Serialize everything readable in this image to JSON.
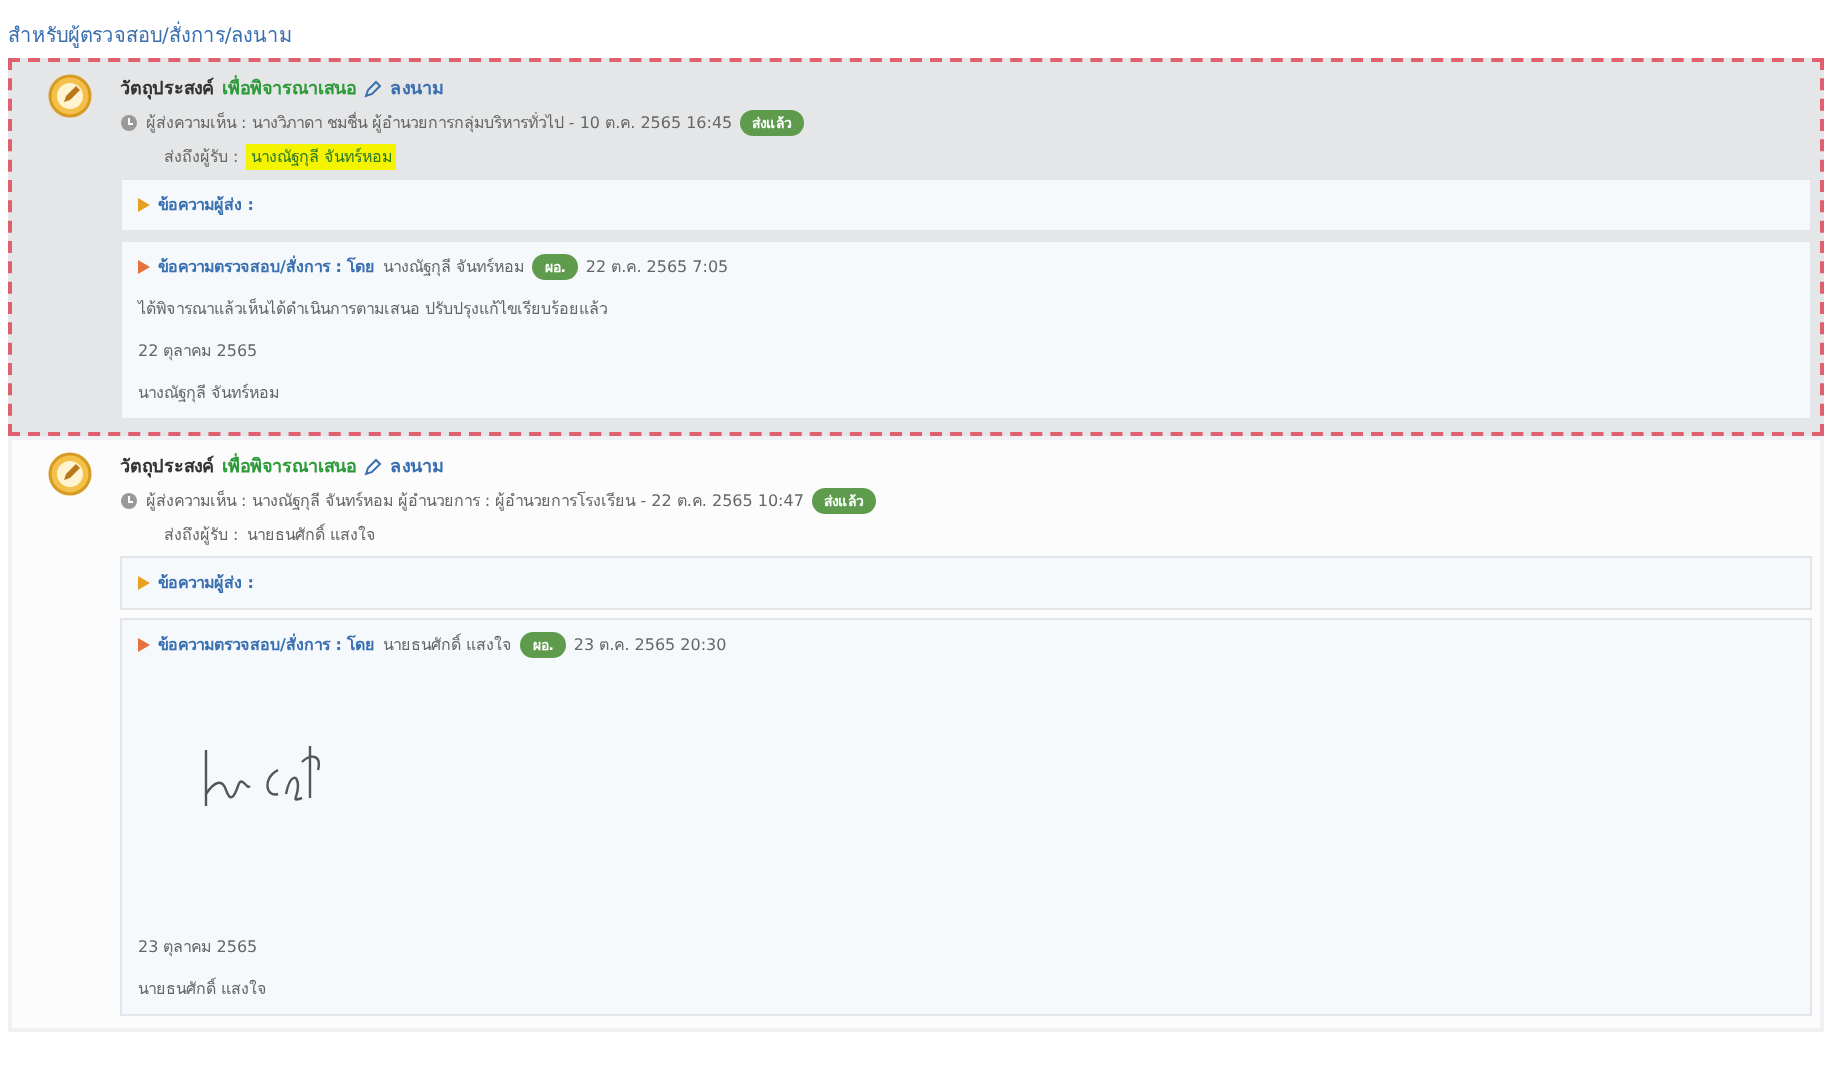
{
  "section_title": "สำหรับผู้ตรวจสอบ/สั่งการ/ลงนาม",
  "entries": [
    {
      "selected": true,
      "purpose_label": "วัตถุประสงค์",
      "purpose": "เพื่อพิจารณาเสนอ",
      "action": "ลงนาม",
      "sender": "ผู้ส่งความเห็น : นางวิภาดา ชมชื่น ผู้อำนวยการกลุ่มบริหารทั่วไป - 10 ต.ค. 2565 16:45",
      "sender_badge": "ส่งแล้ว",
      "recipient_label": "ส่งถึงผู้รับ :",
      "recipient": "นางณัฐกุลี จันทร์หอม",
      "recipient_highlighted": true,
      "sender_message_label": "ข้อความผู้ส่ง :",
      "reply_label": "ข้อความตรวจสอบ/สั่งการ : โดย",
      "reply_by": "นางณัฐกุลี จันทร์หอม",
      "reply_badge": "ผอ.",
      "reply_time": "22 ต.ค. 2565 7:05",
      "body": [
        {
          "kind": "text",
          "text": "ได้พิจารณาแล้วเห็นได้ดำเนินการตามเสนอ ปรับปรุงแก้ไขเรียบร้อยแล้ว"
        },
        {
          "kind": "text",
          "text": "22 ตุลาคม 2565"
        },
        {
          "kind": "text",
          "text": "นางณัฐกุลี จันทร์หอม"
        }
      ]
    },
    {
      "selected": false,
      "purpose_label": "วัตถุประสงค์",
      "purpose": "เพื่อพิจารณาเสนอ",
      "action": "ลงนาม",
      "sender": "ผู้ส่งความเห็น : นางณัฐกุลี จันทร์หอม ผู้อำนวยการ : ผู้อำนวยการโรงเรียน - 22 ต.ค. 2565 10:47",
      "sender_badge": "ส่งแล้ว",
      "recipient_label": "ส่งถึงผู้รับ :",
      "recipient": "นายธนศักดิ์ แสงใจ",
      "recipient_highlighted": false,
      "sender_message_label": "ข้อความผู้ส่ง :",
      "reply_label": "ข้อความตรวจสอบ/สั่งการ : โดย",
      "reply_by": "นายธนศักดิ์ แสงใจ",
      "reply_badge": "ผอ.",
      "reply_time": "23 ต.ค. 2565 20:30",
      "body": [
        {
          "kind": "signature"
        },
        {
          "kind": "text",
          "text": "23 ตุลาคม 2565"
        },
        {
          "kind": "text",
          "text": "นายธนศักดิ์ แสงใจ"
        }
      ]
    }
  ]
}
